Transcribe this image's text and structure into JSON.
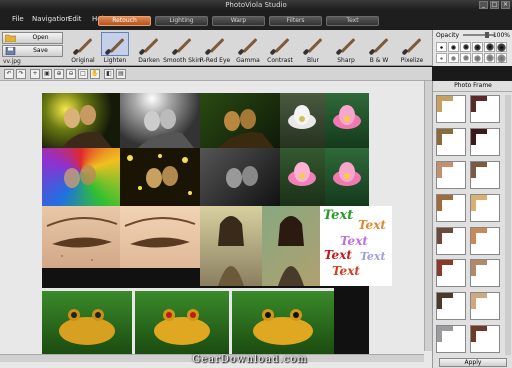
{
  "window": {
    "title": "PhotoViola Studio"
  },
  "menu": [
    "File",
    "Navigation",
    "Edit",
    "Help"
  ],
  "tabs": [
    "Retouch",
    "Lighting",
    "Warp",
    "Filters",
    "Text"
  ],
  "file": {
    "open_label": "Open",
    "save_label": "Save",
    "filename": "vv.jpg"
  },
  "tools": [
    "Original",
    "Lighten",
    "Darken",
    "Smooth Skin",
    "R-Red Eye",
    "Gamma",
    "Contrast",
    "Blur",
    "Sharp",
    "B & W",
    "Pixelize"
  ],
  "opacity": {
    "label": "Opacity",
    "value": "100%"
  },
  "frame_panel": {
    "title": "Photo Frame",
    "apply_label": "Apply"
  },
  "text_sample": [
    "Text",
    "Text",
    "Text",
    "Text",
    "Text",
    "Text"
  ],
  "watermark": "GearDownload.com",
  "colors": {
    "accent_tab": "#c8652a",
    "selected_tool": "#c5cfe8"
  }
}
